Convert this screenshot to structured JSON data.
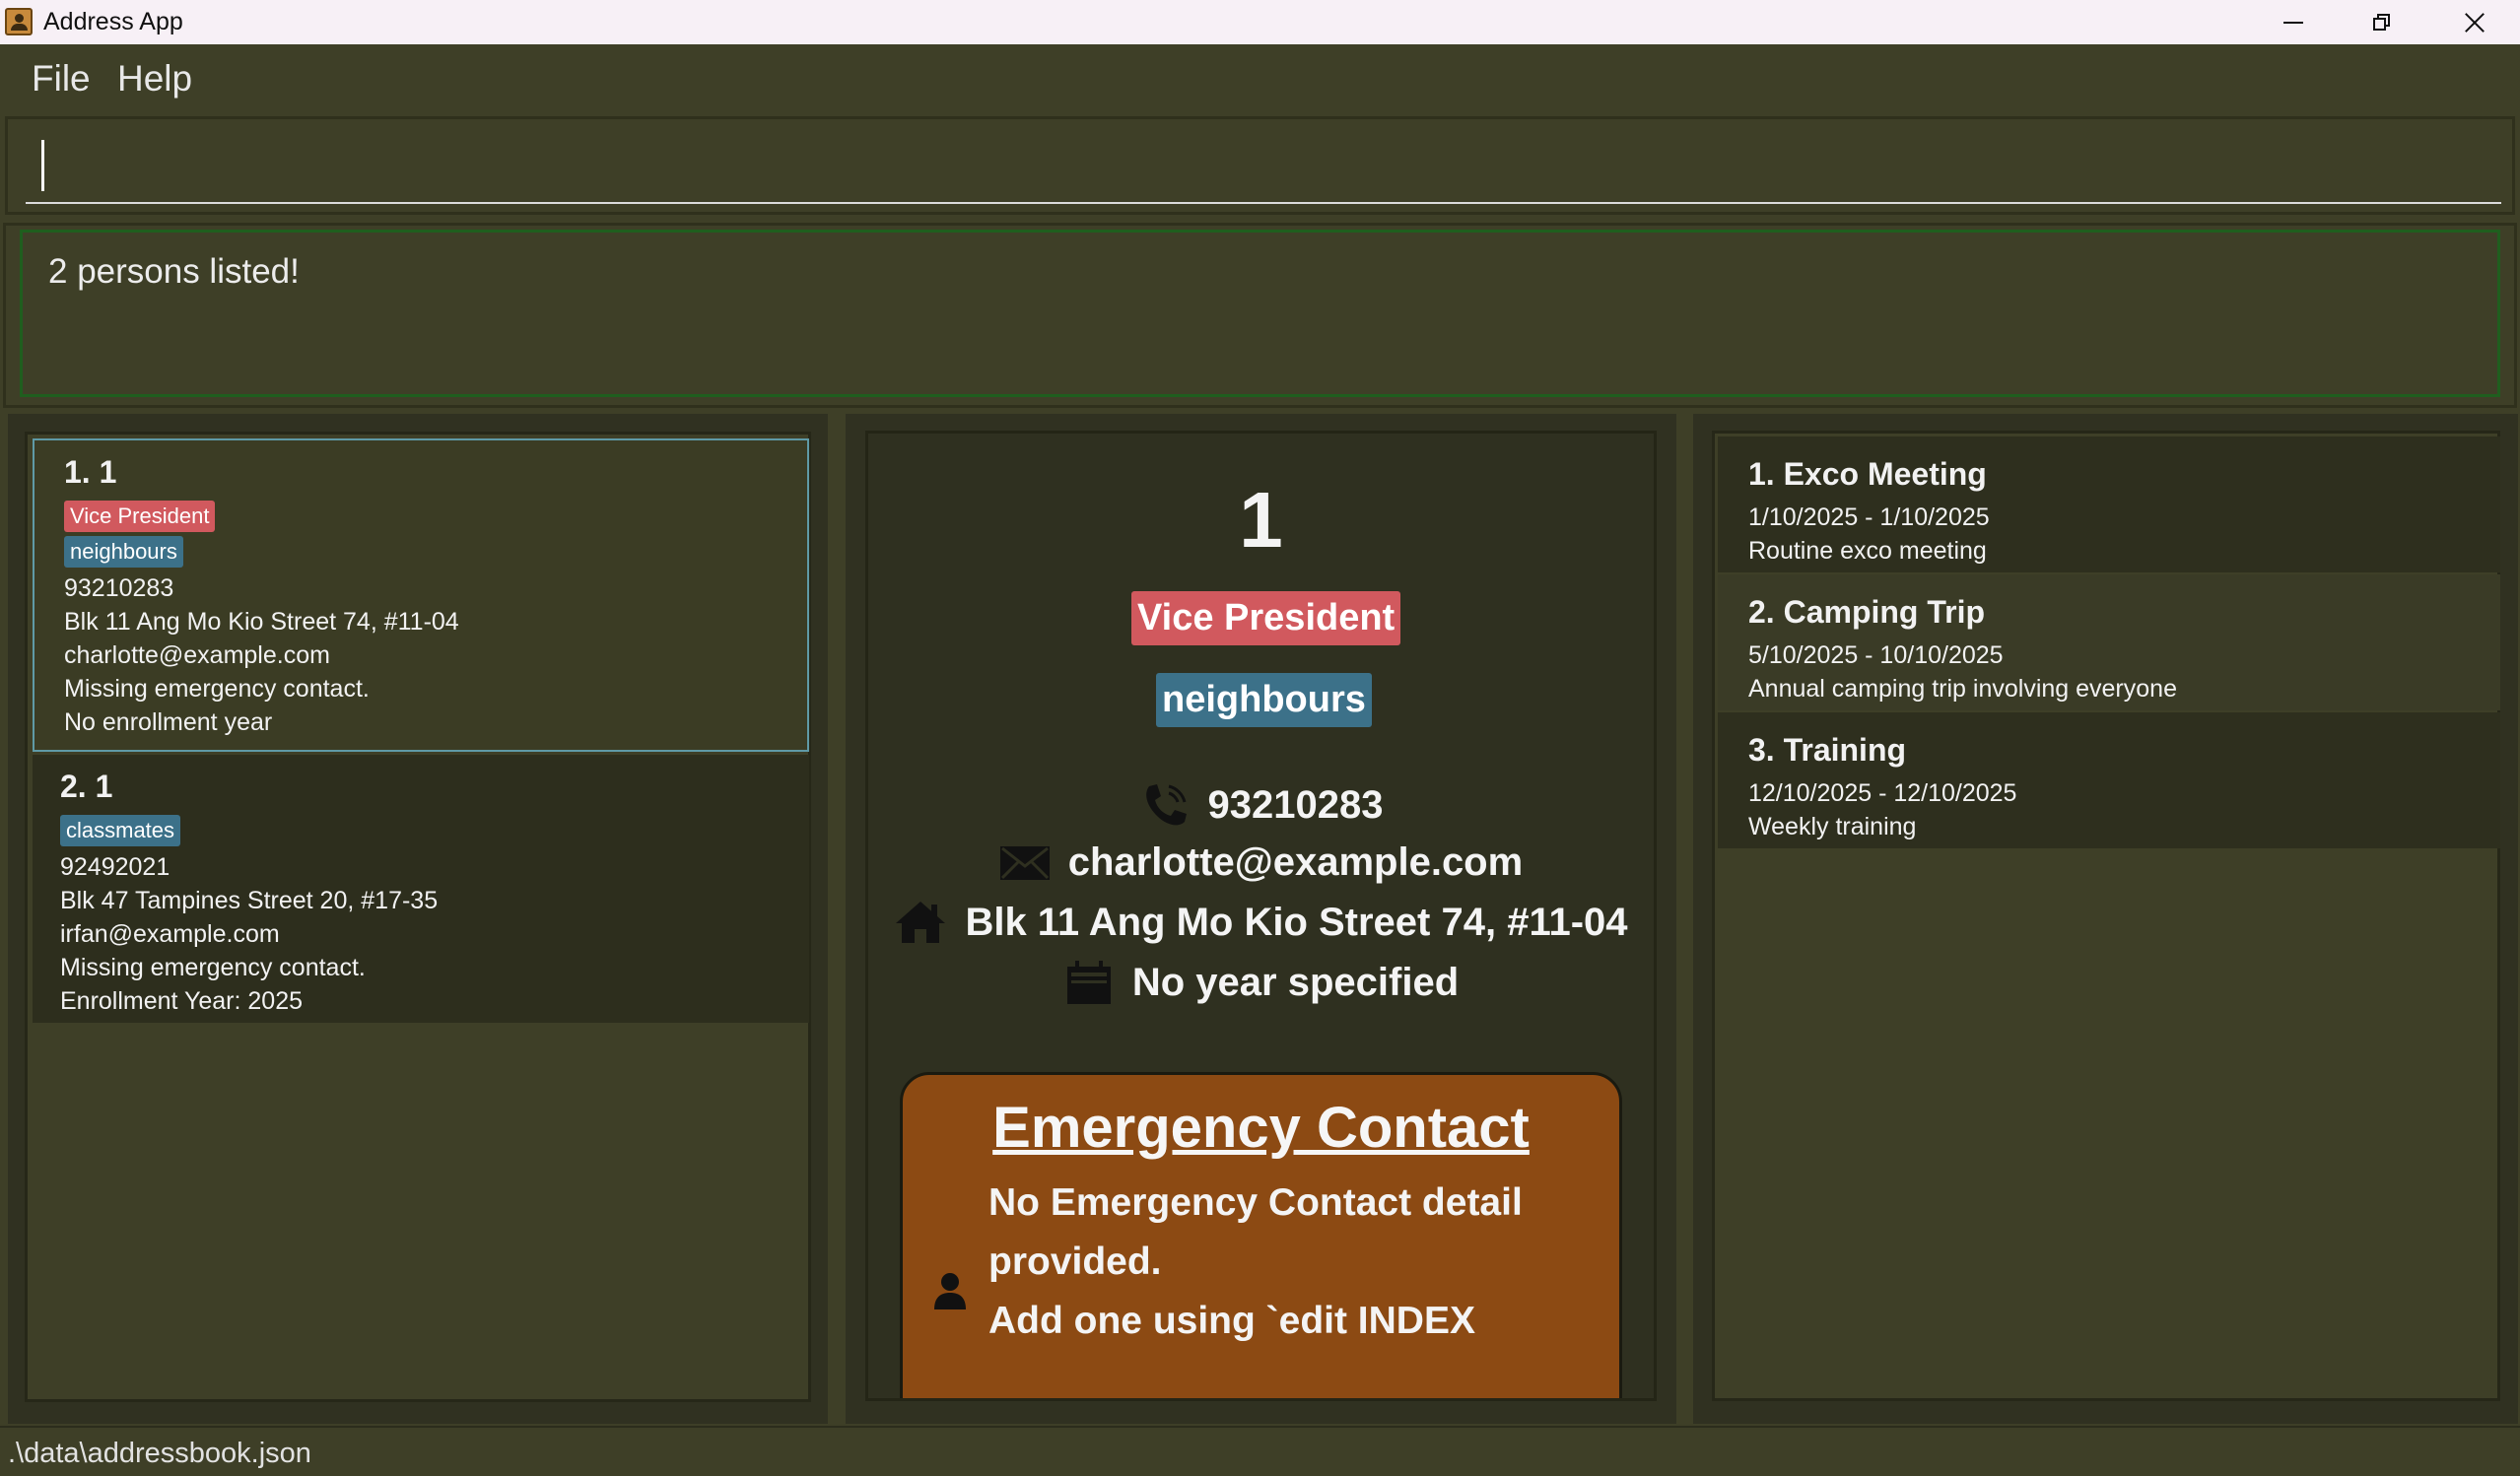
{
  "window": {
    "title": "Address App"
  },
  "menu": {
    "items": [
      "File",
      "Help"
    ]
  },
  "command": {
    "value": "",
    "placeholder": ""
  },
  "result": {
    "message": "2 persons listed!"
  },
  "persons": [
    {
      "index": "1. 1",
      "tags": [
        {
          "label": "Vice President",
          "color": "#d1595e"
        },
        {
          "label": "neighbours",
          "color": "#3c7189"
        }
      ],
      "phone": "93210283",
      "address": "Blk 11 Ang Mo Kio Street 74, #11-04",
      "email": "charlotte@example.com",
      "emergency": "Missing emergency contact.",
      "year": "No enrollment year"
    },
    {
      "index": "2. 1",
      "tags": [
        {
          "label": "classmates",
          "color": "#3c7189"
        }
      ],
      "phone": "92492021",
      "address": "Blk 47 Tampines Street 20, #17-35",
      "email": "irfan@example.com",
      "emergency": "Missing emergency contact.",
      "year": "Enrollment Year: 2025"
    }
  ],
  "detail": {
    "name": "1",
    "role_tag": "Vice President",
    "group_tag": "neighbours",
    "phone": "93210283",
    "email": "charlotte@example.com",
    "address": "Blk 11 Ang Mo Kio Street 74, #11-04",
    "year": "No year specified",
    "emergency_title": "Emergency Contact",
    "emergency_line1": "No Emergency Contact detail provided.",
    "emergency_line2": "Add one using `edit INDEX"
  },
  "events": [
    {
      "title": "1. Exco Meeting",
      "dates": "1/10/2025 - 1/10/2025",
      "description": "Routine exco meeting"
    },
    {
      "title": "2. Camping Trip",
      "dates": "5/10/2025 - 10/10/2025",
      "description": "Annual camping trip involving everyone"
    },
    {
      "title": "3. Training",
      "dates": "12/10/2025 - 12/10/2025",
      "description": "Weekly training"
    }
  ],
  "status": {
    "path": ".\\data\\addressbook.json"
  },
  "colors": {
    "background": "#3e3f27",
    "role_tag": "#d1595e",
    "group_tag": "#3c7189",
    "emergency": "#8c4a13"
  },
  "icons": {
    "phone": "phone-icon",
    "email": "envelope-icon",
    "address": "home-icon",
    "year": "calendar-icon",
    "emergency": "person-icon"
  }
}
